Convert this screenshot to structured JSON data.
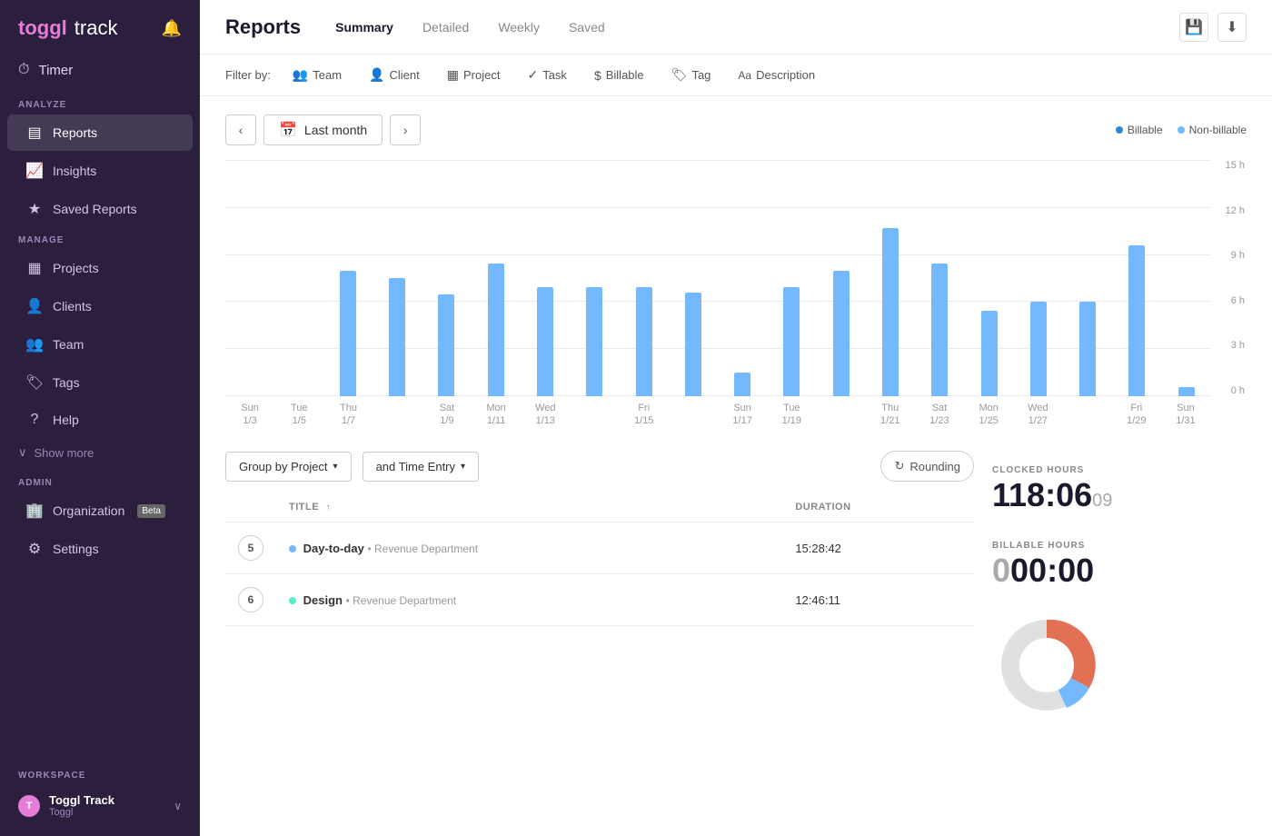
{
  "sidebar": {
    "logo": "toggl",
    "logoTrack": "track",
    "timer_label": "Timer",
    "analyze_label": "ANALYZE",
    "manage_label": "MANAGE",
    "admin_label": "ADMIN",
    "workspace_label": "WORKSPACE",
    "nav_items_analyze": [
      {
        "id": "reports",
        "label": "Reports",
        "icon": "▤",
        "active": true
      },
      {
        "id": "insights",
        "label": "Insights",
        "icon": "📈"
      },
      {
        "id": "saved-reports",
        "label": "Saved Reports",
        "icon": "★"
      }
    ],
    "nav_items_manage": [
      {
        "id": "projects",
        "label": "Projects",
        "icon": "▦"
      },
      {
        "id": "clients",
        "label": "Clients",
        "icon": "👤"
      },
      {
        "id": "team",
        "label": "Team",
        "icon": "👥"
      },
      {
        "id": "tags",
        "label": "Tags",
        "icon": "🏷"
      },
      {
        "id": "help",
        "label": "Help",
        "icon": "?"
      }
    ],
    "show_more_label": "Show more",
    "nav_items_admin": [
      {
        "id": "organization",
        "label": "Organization",
        "badge": "Beta",
        "icon": "🏢"
      },
      {
        "id": "settings",
        "label": "Settings",
        "icon": "⚙"
      }
    ],
    "workspace_name": "Toggl Track",
    "workspace_sub": "Toggl"
  },
  "topbar": {
    "title": "Reports",
    "tabs": [
      {
        "id": "summary",
        "label": "Summary",
        "active": true
      },
      {
        "id": "detailed",
        "label": "Detailed"
      },
      {
        "id": "weekly",
        "label": "Weekly"
      },
      {
        "id": "saved",
        "label": "Saved"
      }
    ],
    "save_icon": "💾",
    "download_icon": "⬇"
  },
  "filter_bar": {
    "label": "Filter by:",
    "filters": [
      {
        "id": "team",
        "label": "Team",
        "icon": "👥"
      },
      {
        "id": "client",
        "label": "Client",
        "icon": "👤"
      },
      {
        "id": "project",
        "label": "Project",
        "icon": "▦"
      },
      {
        "id": "task",
        "label": "Task",
        "icon": "✓"
      },
      {
        "id": "billable",
        "label": "Billable",
        "icon": "$"
      },
      {
        "id": "tag",
        "label": "Tag",
        "icon": "🏷"
      },
      {
        "id": "description",
        "label": "Description",
        "icon": "Aa"
      }
    ]
  },
  "date_nav": {
    "prev_label": "‹",
    "next_label": "›",
    "range_label": "Last month",
    "cal_icon": "📅"
  },
  "legend": {
    "billable_label": "Billable",
    "billable_color": "#2d86d4",
    "nonbillable_label": "Non-billable",
    "nonbillable_color": "#74b9ff"
  },
  "chart": {
    "y_labels": [
      "15 h",
      "12 h",
      "9 h",
      "6 h",
      "3 h",
      "0 h"
    ],
    "max_hours": 15,
    "bars": [
      {
        "day": "Sun",
        "date": "1/3",
        "height_pct": 0
      },
      {
        "day": "Tue",
        "date": "1/5",
        "height_pct": 0
      },
      {
        "day": "Thu",
        "date": "1/7",
        "height_pct": 53
      },
      {
        "day": "",
        "date": "",
        "height_pct": 50
      },
      {
        "day": "Sat",
        "date": "1/9",
        "height_pct": 43
      },
      {
        "day": "Mon",
        "date": "1/11",
        "height_pct": 56
      },
      {
        "day": "Wed",
        "date": "1/13",
        "height_pct": 46
      },
      {
        "day": "",
        "date": "",
        "height_pct": 46
      },
      {
        "day": "Fri",
        "date": "1/15",
        "height_pct": 46
      },
      {
        "day": "",
        "date": "",
        "height_pct": 44
      },
      {
        "day": "Sun",
        "date": "1/17",
        "height_pct": 10
      },
      {
        "day": "Tue",
        "date": "1/19",
        "height_pct": 46
      },
      {
        "day": "",
        "date": "",
        "height_pct": 53
      },
      {
        "day": "Thu",
        "date": "1/21",
        "height_pct": 71
      },
      {
        "day": "Sat",
        "date": "1/23",
        "height_pct": 56
      },
      {
        "day": "Mon",
        "date": "1/25",
        "height_pct": 36
      },
      {
        "day": "Wed",
        "date": "1/27",
        "height_pct": 40
      },
      {
        "day": "",
        "date": "",
        "height_pct": 40
      },
      {
        "day": "Fri",
        "date": "1/29",
        "height_pct": 64
      },
      {
        "day": "Sun",
        "date": "1/31",
        "height_pct": 4
      }
    ]
  },
  "group_controls": {
    "group_by_label": "Group by Project",
    "time_entry_label": "and Time Entry",
    "rounding_label": "Rounding"
  },
  "table": {
    "columns": [
      {
        "id": "title",
        "label": "TITLE",
        "sortable": true
      },
      {
        "id": "duration",
        "label": "DURATION"
      }
    ],
    "rows": [
      {
        "badge": "5",
        "project_name": "Day-to-day",
        "project_color": "#74b9ff",
        "client": "Revenue Department",
        "duration": "15:28:42"
      },
      {
        "badge": "6",
        "project_name": "Design",
        "project_color": "#55efc4",
        "client": "Revenue Department",
        "duration": "12:46:11"
      }
    ]
  },
  "stats": {
    "clocked_label": "CLOCKED HOURS",
    "clocked_main": "118:06",
    "clocked_small": "09",
    "billable_label": "BILLABLE HOURS",
    "billable_zero": "0",
    "billable_main": "00:00"
  }
}
